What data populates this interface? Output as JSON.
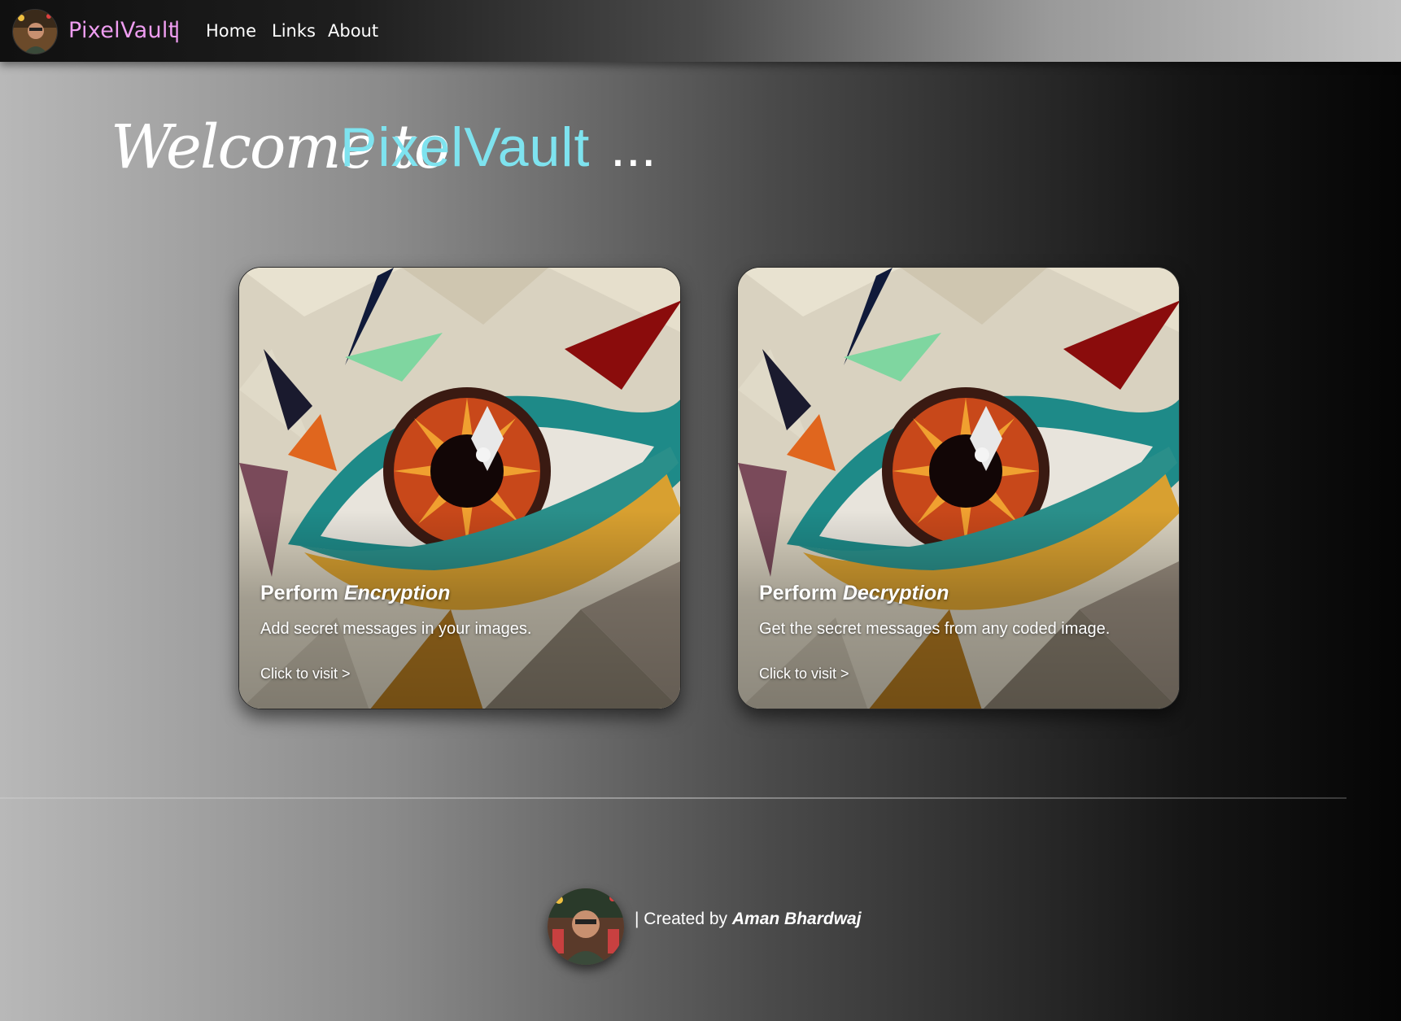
{
  "nav": {
    "brand": "PixelVault",
    "separator": "|",
    "links": [
      {
        "label": "Home"
      },
      {
        "label": "Links"
      },
      {
        "label": "About"
      }
    ]
  },
  "hero": {
    "welcome": "Welcome to",
    "brand": "PixelVault",
    "dots": "..."
  },
  "cards": [
    {
      "title_prefix": "Perform",
      "title_emphasis": "Encryption",
      "description": "Add secret messages in your images.",
      "link": "Click to visit >"
    },
    {
      "title_prefix": "Perform",
      "title_emphasis": "Decryption",
      "description": "Get the secret messages from any coded image.",
      "link": "Click to visit >"
    }
  ],
  "footer": {
    "prefix": "| Created by",
    "author": "Aman Bhardwaj"
  },
  "colors": {
    "brand_pink": "#ee9df0",
    "hero_cyan": "#7ee3ef"
  },
  "icons": {
    "nav_avatar": "user-avatar-icon",
    "footer_avatar": "author-avatar-icon"
  }
}
